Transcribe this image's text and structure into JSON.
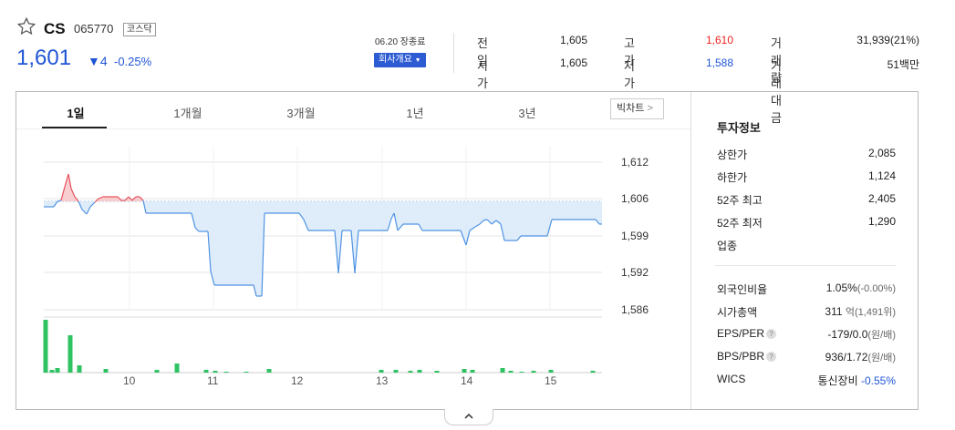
{
  "header": {
    "name": "CS",
    "code": "065770",
    "market": "코스닥",
    "price": "1,601",
    "change": "4",
    "change_pct": "-0.25%",
    "time_label": "06.20 장종료",
    "company_button": "회사개요",
    "summary": [
      {
        "label": "전일",
        "value": "1,605"
      },
      {
        "label": "고가",
        "value": "1,610",
        "color": "#e22222"
      },
      {
        "label": "거래량",
        "value": "31,939(21%)"
      },
      {
        "label": "시가",
        "value": "1,605"
      },
      {
        "label": "저가",
        "value": "1,588",
        "color": "#2156d6"
      },
      {
        "label": "거래대금",
        "value": "51백만"
      }
    ]
  },
  "tabs": [
    "1일",
    "1개월",
    "3개월",
    "1년",
    "3년"
  ],
  "big_chart_button": "빅차트",
  "chart_data": {
    "type": "line",
    "reference_price": 1605,
    "y_ticks": [
      "1,612",
      "1,606",
      "1,599",
      "1,592",
      "1,586"
    ],
    "x_ticks": [
      "10",
      "11",
      "12",
      "13",
      "14",
      "15"
    ],
    "price_up_color": "#e8505b",
    "price_down_color": "#4f93e3",
    "volume_color": "#2ec262"
  },
  "invest": {
    "title": "투자정보",
    "rows1": [
      {
        "label": "상한가",
        "value": "2,085",
        "color": "#e22222"
      },
      {
        "label": "하한가",
        "value": "1,124",
        "color": "#2156d6"
      },
      {
        "label": "52주 최고",
        "value": "2,405"
      },
      {
        "label": "52주 최저",
        "value": "1,290"
      },
      {
        "label": "업종",
        "value": ""
      }
    ],
    "foreign_label": "외국인비율",
    "foreign_value": "1.05%",
    "foreign_change": "(-0.00%)",
    "mcap_label": "시가총액",
    "mcap_value": "311",
    "mcap_unit": "억",
    "mcap_rank": "(1,491위)",
    "eps_label": "EPS/PER",
    "eps_value": "-179/0.0",
    "eps_unit": "(원/배)",
    "bps_label": "BPS/PBR",
    "bps_value": "936/1.72",
    "bps_unit": "(원/배)",
    "wics_label": "WICS",
    "wics_value": "통신장비",
    "wics_change": "-0.55%"
  }
}
